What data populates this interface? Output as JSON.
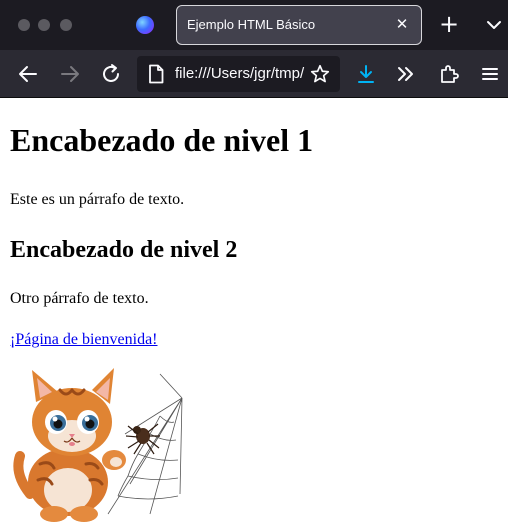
{
  "browser": {
    "tab_title": "Ejemplo HTML Básico",
    "tab_close_glyph": "✕",
    "new_tab_glyph": "+",
    "url": "file:///Users/jgr/tmp/",
    "colors": {
      "titlebar": "#1c1b22",
      "navbar": "#2b2a33",
      "download_accent": "#00b3f4"
    },
    "icons": [
      "back-arrow-icon",
      "forward-arrow-icon",
      "reload-icon",
      "page-icon",
      "bookmark-star-icon",
      "download-icon",
      "overflow-chevrons-icon",
      "extensions-icon",
      "hamburger-menu-icon",
      "tab-list-chevron-icon",
      "firefox-logo-icon"
    ]
  },
  "page": {
    "h1": "Encabezado de nivel 1",
    "p1": "Este es un párrafo de texto.",
    "h2": "Encabezado de nivel 2",
    "p2": "Otro párrafo de texto.",
    "link": "¡Página de bienvenida!",
    "image_subject": "kitten-and-spider-illustration"
  }
}
